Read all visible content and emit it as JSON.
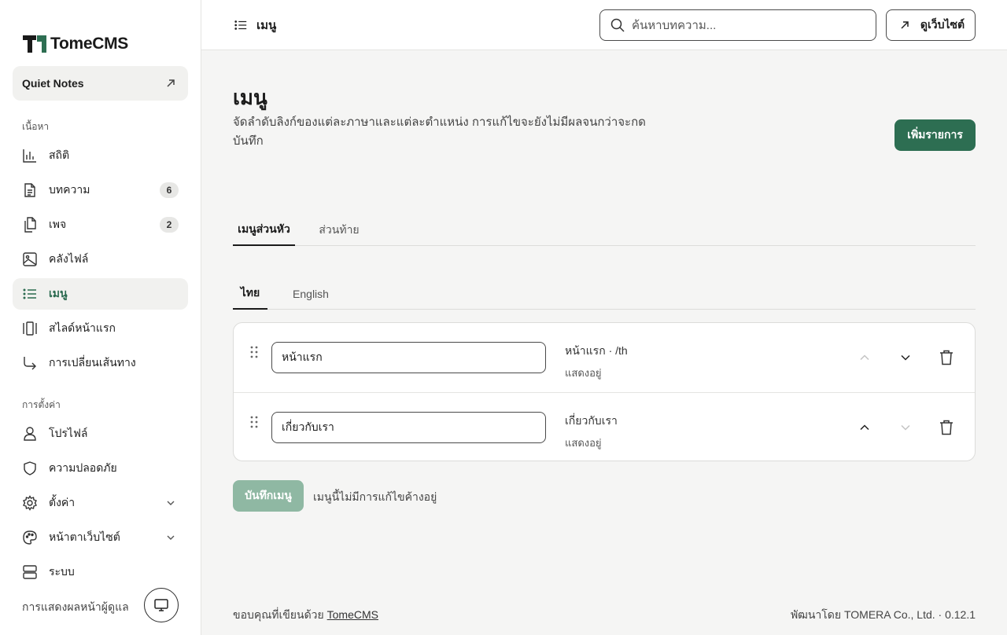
{
  "brand": {
    "name": "TomeCMS",
    "accent": "#2d6e52"
  },
  "site": {
    "name": "Quiet Notes",
    "open_icon": "arrow-up-right-icon"
  },
  "sidebar": {
    "content_label": "เนื้อหา",
    "settings_label": "การตั้งค่า",
    "items": [
      {
        "label": "สถิติ",
        "icon": "bar-chart-icon"
      },
      {
        "label": "บทความ",
        "icon": "file-text-icon",
        "badge": "6"
      },
      {
        "label": "เพจ",
        "icon": "files-icon",
        "badge": "2"
      },
      {
        "label": "คลังไฟล์",
        "icon": "image-icon"
      },
      {
        "label": "เมนู",
        "icon": "list-icon",
        "active": true
      },
      {
        "label": "สไลด์หน้าแรก",
        "icon": "gallery-icon"
      },
      {
        "label": "การเปลี่ยนเส้นทาง",
        "icon": "redirect-icon"
      }
    ],
    "settings_items": [
      {
        "label": "โปรไฟล์",
        "icon": "user-icon"
      },
      {
        "label": "ความปลอดภัย",
        "icon": "shield-icon"
      },
      {
        "label": "ตั้งค่า",
        "icon": "gear-icon",
        "expandable": true
      },
      {
        "label": "หน้าตาเว็บไซต์",
        "icon": "palette-icon",
        "expandable": true
      },
      {
        "label": "ระบบ",
        "icon": "server-icon"
      }
    ],
    "admin_display_label": "การแสดงผลหน้าผู้ดูแล"
  },
  "topbar": {
    "title": "เมนู",
    "search_placeholder": "ค้นหาบทความ...",
    "view_site_label": "ดูเว็บไซต์"
  },
  "main": {
    "title": "เมนู",
    "description": "จัดลำดับลิงก์ของแต่ละภาษาและแต่ละตำแหน่ง การแก้ไขจะยังไม่มีผลจนกว่าจะกดบันทึก",
    "add_button": "เพิ่มรายการ",
    "location_tabs": [
      {
        "label": "เมนูส่วนหัว",
        "active": true
      },
      {
        "label": "ส่วนท้าย",
        "active": false
      }
    ],
    "language_tabs": [
      {
        "label": "ไทย",
        "active": true
      },
      {
        "label": "English",
        "active": false
      }
    ],
    "menu_items": [
      {
        "label": "หน้าแรก",
        "target": "หน้าแรก · /th",
        "status": "แสดงอยู่",
        "can_move_up": false,
        "can_move_down": true
      },
      {
        "label": "เกี่ยวกับเรา",
        "target": "เกี่ยวกับเรา",
        "status": "แสดงอยู่",
        "can_move_up": true,
        "can_move_down": false
      }
    ],
    "save_button": "บันทึกเมนู",
    "save_hint": "เมนูนี้ไม่มีการแก้ไขค้างอยู่"
  },
  "footer": {
    "thanks_prefix": "ขอบคุณที่เขียนด้วย",
    "thanks_link": "TomeCMS",
    "credit": "พัฒนาโดย TOMERA Co., Ltd. · 0.12.1"
  }
}
